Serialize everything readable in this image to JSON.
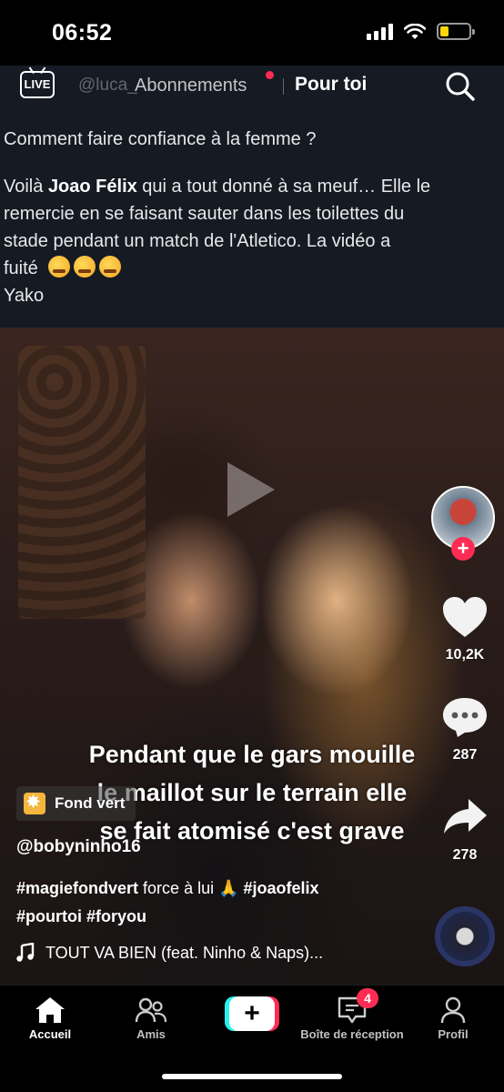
{
  "status_bar": {
    "time": "06:52",
    "battery_level": 0.3,
    "battery_color": "#ffd60a"
  },
  "top_nav": {
    "live_label": "LIVE",
    "ghost_handle": "@luca_",
    "tab_following": "Abonnements",
    "tab_for_you": "Pour toi",
    "notification_dot_color": "#fe2c55"
  },
  "tweet": {
    "line1": "Comment faire confiance à la femme ?",
    "line2_pre": "Voilà ",
    "line2_bold": "Joao Félix",
    "line2_post": " qui a tout donné à sa meuf… Elle le",
    "line3": "remercie en se faisant sauter dans les toilettes du",
    "line4": "stade pendant un match de l'Atletico. La vidéo a",
    "line5": "fuité",
    "line6": "Yako"
  },
  "video": {
    "caption_line1": "Pendant que le gars mouille",
    "caption_line2": "le maillot sur le terrain elle",
    "caption_line3": "se fait atomisé c'est grave"
  },
  "right_rail": {
    "likes": "10,2K",
    "comments": "287",
    "shares": "278"
  },
  "post": {
    "effect_label": "Fond vert",
    "username": "@bobyninho16",
    "desc_tag1": "#magiefondvert",
    "desc_text": " force à lui 🙏 ",
    "desc_tag2": "#joaofelix",
    "desc_line2": "#pourtoi #foryou",
    "music": "TOUT VA BIEN (feat. Ninho & Naps)..."
  },
  "tabbar": {
    "home": "Accueil",
    "friends": "Amis",
    "inbox": "Boîte de réception",
    "inbox_badge": "4",
    "profile": "Profil"
  },
  "colors": {
    "accent": "#fe2c55",
    "cyan": "#25f4ee"
  }
}
